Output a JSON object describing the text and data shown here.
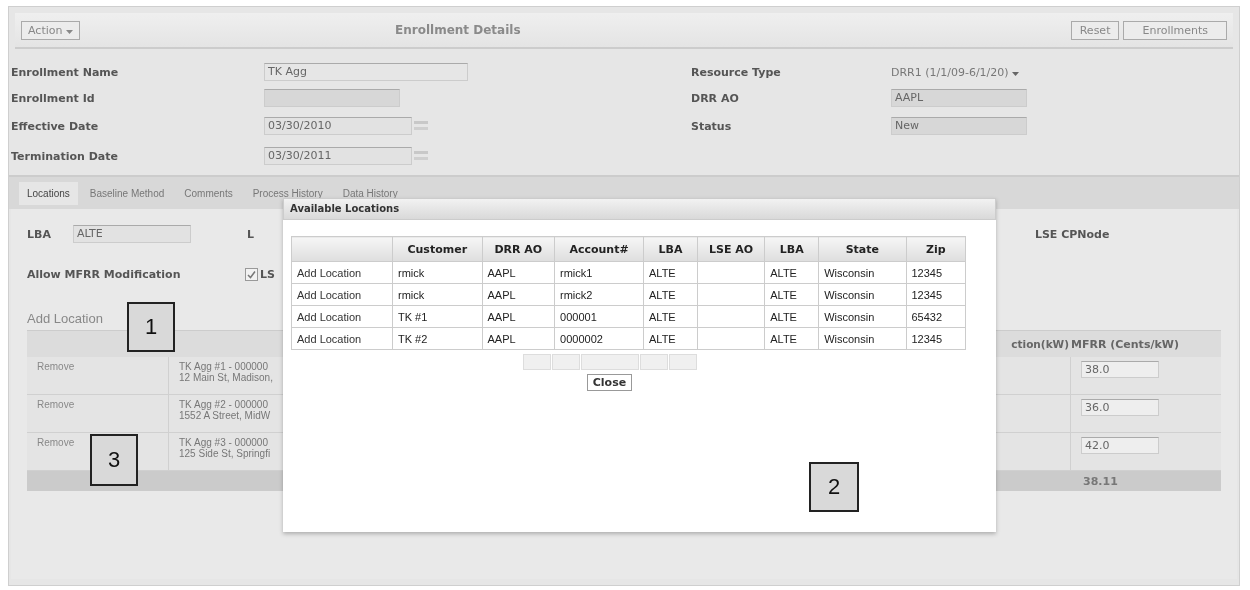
{
  "header": {
    "action_menu": "Action",
    "title": "Enrollment Details",
    "buttons": [
      "Reset",
      "Enrollments"
    ]
  },
  "form": {
    "left": [
      {
        "label": "Enrollment Name",
        "kind": "text",
        "value": "TK Agg"
      },
      {
        "label": "Enrollment Id",
        "kind": "readonly"
      },
      {
        "label": "Effective Date",
        "kind": "date",
        "value": "03/30/2010"
      },
      {
        "label": "Termination Date",
        "kind": "date",
        "value": "03/30/2011"
      }
    ],
    "right": [
      {
        "label": "Resource Type",
        "kind": "select",
        "value": "DRR1 (1/1/09-6/1/20)"
      },
      {
        "label": "DRR AO",
        "kind": "readonly",
        "value": "AAPL"
      },
      {
        "label": "Status",
        "kind": "readonly",
        "value": "New"
      }
    ]
  },
  "tabs": [
    {
      "label": "Locations",
      "selected": true
    },
    {
      "label": "Baseline Method",
      "selected": false
    },
    {
      "label": "Comments",
      "selected": false
    },
    {
      "label": "Process History",
      "selected": false
    },
    {
      "label": "Data History",
      "selected": false
    }
  ],
  "locations": {
    "lba_label": "LBA",
    "lba_value": "ALTE",
    "hidden_label": "L",
    "cpnode_label": "LSE CPNode",
    "allow_label": "Allow MFRR Modification",
    "checkbox": {
      "label": "LS",
      "checked": true
    },
    "add_location": "Add Location",
    "columns": [
      "ction(kW)",
      "MFRR (Cents/kW)"
    ],
    "rows": [
      {
        "action": "Remove",
        "line1": "TK Agg #1 - 000000",
        "line2": "12 Main St, Madison,",
        "mfrr": "38.0"
      },
      {
        "action": "Remove",
        "line1": "TK Agg #2 - 000000",
        "line2": "1552 A Street, MidW",
        "mfrr": "36.0"
      },
      {
        "action": "Remove",
        "line1": "TK Agg #3 - 000000",
        "line2": "125 Side St, Springfi",
        "mfrr": "42.0"
      }
    ],
    "total": "38.11"
  },
  "dialog": {
    "title": "Available Locations",
    "columns": [
      "Customer",
      "DRR AO",
      "Account#",
      "LBA",
      "LSE AO",
      "LBA",
      "State",
      "Zip"
    ],
    "rows": [
      {
        "action": "Add Location",
        "cells": [
          "rmick",
          "AAPL",
          "rmick1",
          "ALTE",
          null,
          "ALTE",
          "Wisconsin",
          "12345"
        ]
      },
      {
        "action": "Add Location",
        "cells": [
          "rmick",
          "AAPL",
          "rmick2",
          "ALTE",
          null,
          "ALTE",
          "Wisconsin",
          "12345"
        ]
      },
      {
        "action": "Add Location",
        "cells": [
          "TK #1",
          "AAPL",
          "000001",
          "ALTE",
          null,
          "ALTE",
          "Wisconsin",
          "65432"
        ]
      },
      {
        "action": "Add Location",
        "cells": [
          "TK #2",
          "AAPL",
          "0000002",
          "ALTE",
          null,
          "ALTE",
          "Wisconsin",
          "12345"
        ]
      }
    ],
    "close": "Close"
  },
  "callouts": [
    {
      "label": "1"
    },
    {
      "label": "2"
    },
    {
      "label": "3"
    }
  ]
}
